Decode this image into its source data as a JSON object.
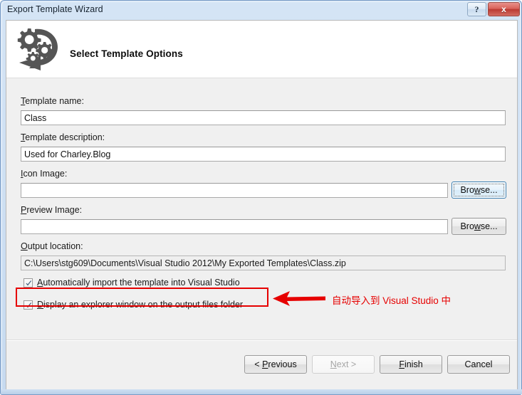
{
  "window": {
    "title": "Export Template Wizard",
    "help_button": "?",
    "close_button": "x"
  },
  "header": {
    "title": "Select Template Options",
    "icon": "export-gears-icon"
  },
  "form": {
    "template_name": {
      "label_prefix": "",
      "label_accesskey": "T",
      "label_rest": "emplate name:",
      "value": "Class"
    },
    "template_description": {
      "label_accesskey": "T",
      "label_rest": "emplate description:",
      "value": "Used for Charley.Blog"
    },
    "icon_image": {
      "label_accesskey": "I",
      "label_rest": "con Image:",
      "value": "",
      "browse_label_prefix": "Bro",
      "browse_label_accesskey": "w",
      "browse_label_rest": "se..."
    },
    "preview_image": {
      "label_accesskey": "P",
      "label_rest": "review Image:",
      "value": "",
      "browse_label_prefix": "Bro",
      "browse_label_accesskey": "w",
      "browse_label_rest": "se..."
    },
    "output_location": {
      "label_accesskey": "O",
      "label_rest": "utput location:",
      "value": "C:\\Users\\stg609\\Documents\\Visual Studio 2012\\My Exported Templates\\Class.zip"
    },
    "checkbox_auto_import": {
      "checked": true,
      "label_accesskey": "A",
      "label_rest": "utomatically import the template into Visual Studio"
    },
    "checkbox_display_explorer": {
      "checked": true,
      "label_accesskey": "D",
      "label_rest": "isplay an explorer window on the output files folder"
    }
  },
  "footer": {
    "previous_prefix": "< ",
    "previous_accesskey": "P",
    "previous_rest": "revious",
    "next_accesskey": "N",
    "next_rest": "ext >",
    "next_disabled": true,
    "finish_prefix": "",
    "finish_accesskey": "F",
    "finish_rest": "inish",
    "cancel_label": "Cancel"
  },
  "annotation": {
    "color": "#e60000",
    "text": "自动导入到 Visual Studio 中",
    "arrow": "left-arrow-icon",
    "highlight_target": "checkbox_auto_import"
  }
}
